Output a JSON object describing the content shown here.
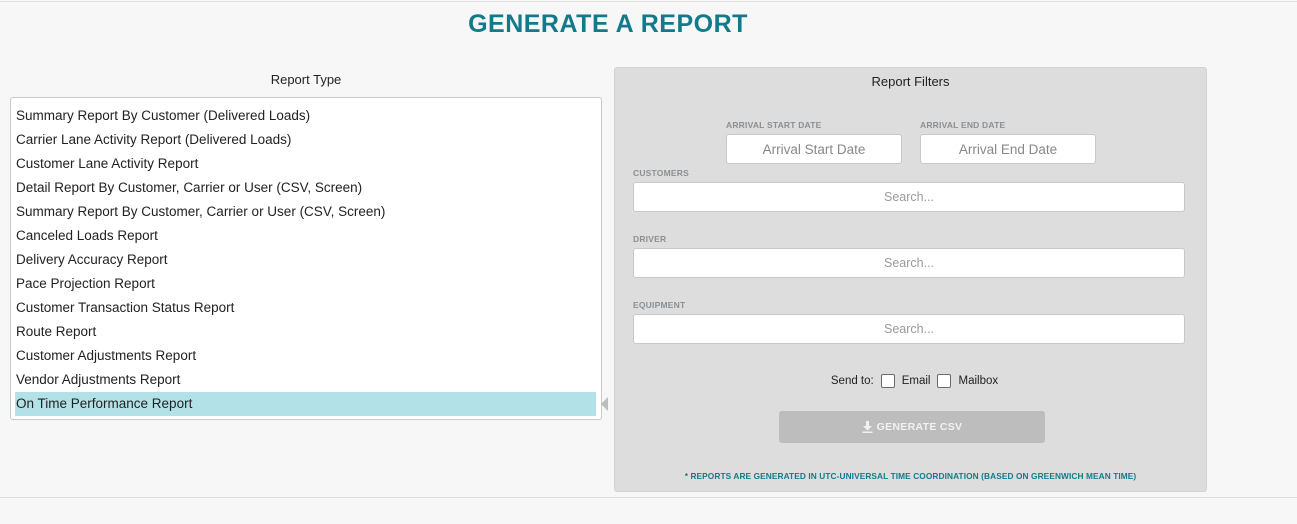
{
  "page": {
    "title": "GENERATE A REPORT"
  },
  "report_type": {
    "label": "Report Type",
    "items": [
      "Summary Report By Customer (Delivered Loads)",
      "Carrier Lane Activity Report (Delivered Loads)",
      "Customer Lane Activity Report",
      "Detail Report By Customer, Carrier or User (CSV, Screen)",
      "Summary Report By Customer, Carrier or User (CSV, Screen)",
      "Canceled Loads Report",
      "Delivery Accuracy Report",
      "Pace Projection Report",
      "Customer Transaction Status Report",
      "Route Report",
      "Customer Adjustments Report",
      "Vendor Adjustments Report",
      "On Time Performance Report"
    ],
    "selected": "On Time Performance Report"
  },
  "filters": {
    "title": "Report Filters",
    "arrival_start": {
      "label": "ARRIVAL START DATE",
      "placeholder": "Arrival Start Date"
    },
    "arrival_end": {
      "label": "ARRIVAL END DATE",
      "placeholder": "Arrival End Date"
    },
    "customers": {
      "label": "CUSTOMERS",
      "placeholder": "Search..."
    },
    "driver": {
      "label": "DRIVER",
      "placeholder": "Search..."
    },
    "equipment": {
      "label": "EQUIPMENT",
      "placeholder": "Search..."
    },
    "send_to": {
      "label": "Send to:",
      "email": "Email",
      "mailbox": "Mailbox"
    },
    "generate_button": "GENERATE CSV",
    "note": "* REPORTS ARE GENERATED IN UTC-UNIVERSAL TIME COORDINATION (BASED ON GREENWICH MEAN TIME)"
  },
  "colors": {
    "accent": "#127a8a",
    "selected_row": "#b2e2e8",
    "panel_bg": "#dedddd",
    "button_disabled": "#bdbdbd"
  }
}
